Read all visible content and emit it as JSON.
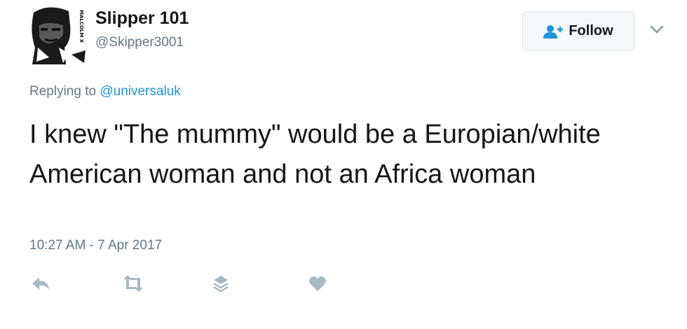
{
  "author": {
    "display_name": "Slipper 101",
    "handle": "@Skipper3001",
    "avatar_text": "MALCOLM X"
  },
  "follow_button": {
    "label": "Follow",
    "icon": "add-user-icon"
  },
  "menu": {
    "icon": "chevron-down-icon"
  },
  "reply": {
    "prefix": "Replying to",
    "mention": "@universaluk"
  },
  "tweet": {
    "text": "I knew \"The mummy\" would be a Europian/white American woman and not an Africa woman",
    "timestamp": "10:27 AM - 7 Apr 2017"
  },
  "actions": [
    {
      "icon": "reply-icon"
    },
    {
      "icon": "retweet-icon"
    },
    {
      "icon": "layers-icon"
    },
    {
      "icon": "heart-icon"
    }
  ],
  "colors": {
    "text_primary": "#14171a",
    "text_secondary": "#657786",
    "link": "#1b95e0",
    "icon_gray": "#aab8c2",
    "button_bg": "#f5f8fa",
    "button_border": "#e1e8ed"
  }
}
